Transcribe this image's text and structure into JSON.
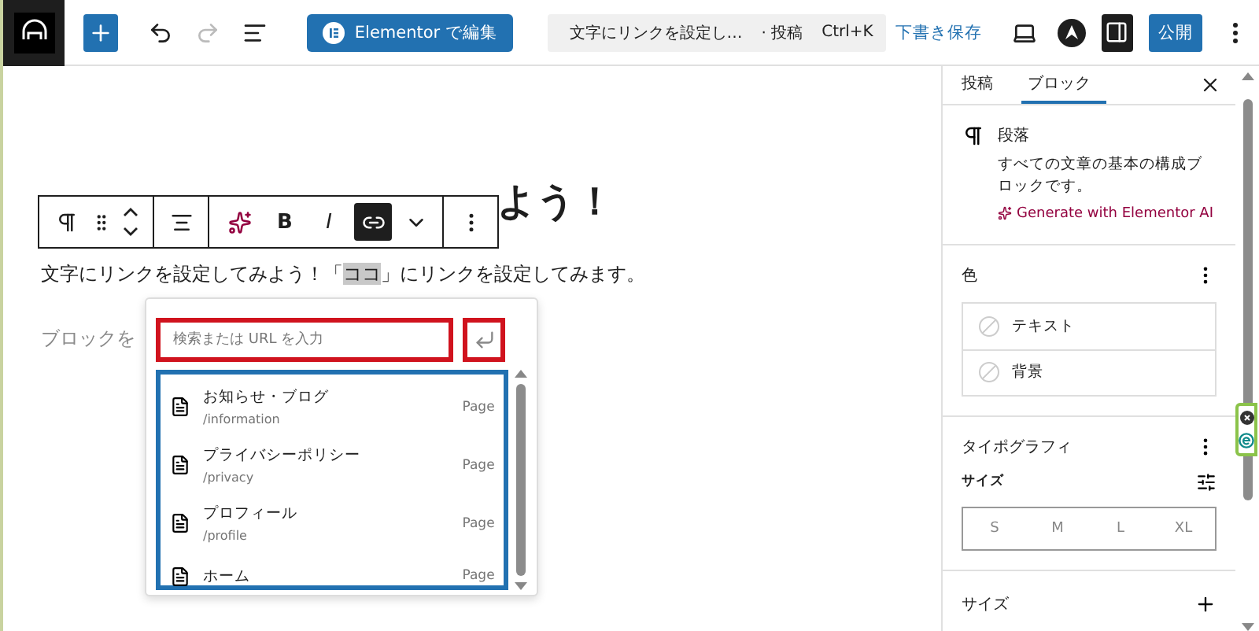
{
  "topbar": {
    "elementor_button": "Elementor で編集",
    "command_title": "文字にリンクを設定し…",
    "command_type": "· 投稿",
    "command_shortcut": "Ctrl+K",
    "save_draft": "下書き保存",
    "publish": "公開",
    "settings_open": true
  },
  "editor": {
    "heading": "よう！",
    "toolbar": {
      "bold": "B",
      "italic": "I",
      "link_active": true
    },
    "paragraph": {
      "before": "文字にリンクを設定してみよう！「",
      "highlight": "ココ",
      "after": "」にリンクを設定してみます。"
    },
    "placeholder": "ブロックを",
    "link_popover": {
      "placeholder": "検索または URL を入力",
      "results": [
        {
          "title": "お知らせ・ブログ",
          "path": "/information",
          "type": "Page"
        },
        {
          "title": "プライバシーポリシー",
          "path": "/privacy",
          "type": "Page"
        },
        {
          "title": "プロフィール",
          "path": "/profile",
          "type": "Page"
        },
        {
          "title": "ホーム",
          "type": "Page"
        }
      ]
    }
  },
  "sidebar": {
    "tabs": [
      {
        "label": "投稿",
        "selected": false
      },
      {
        "label": "ブロック",
        "selected": true
      }
    ],
    "block": {
      "title": "段落",
      "description": "すべての文章の基本の構成ブロックです。",
      "ai_link": "Generate with Elementor AI"
    },
    "color": {
      "title": "色",
      "items": [
        "テキスト",
        "背景"
      ]
    },
    "typography": {
      "title": "タイポグラフィ",
      "size_label": "サイズ",
      "sizes": [
        {
          "label": "S",
          "selected": false
        },
        {
          "label": "M",
          "selected": false
        },
        {
          "label": "L",
          "selected": false
        },
        {
          "label": "XL",
          "selected": false
        }
      ]
    },
    "extra": {
      "title": "サイズ"
    }
  }
}
